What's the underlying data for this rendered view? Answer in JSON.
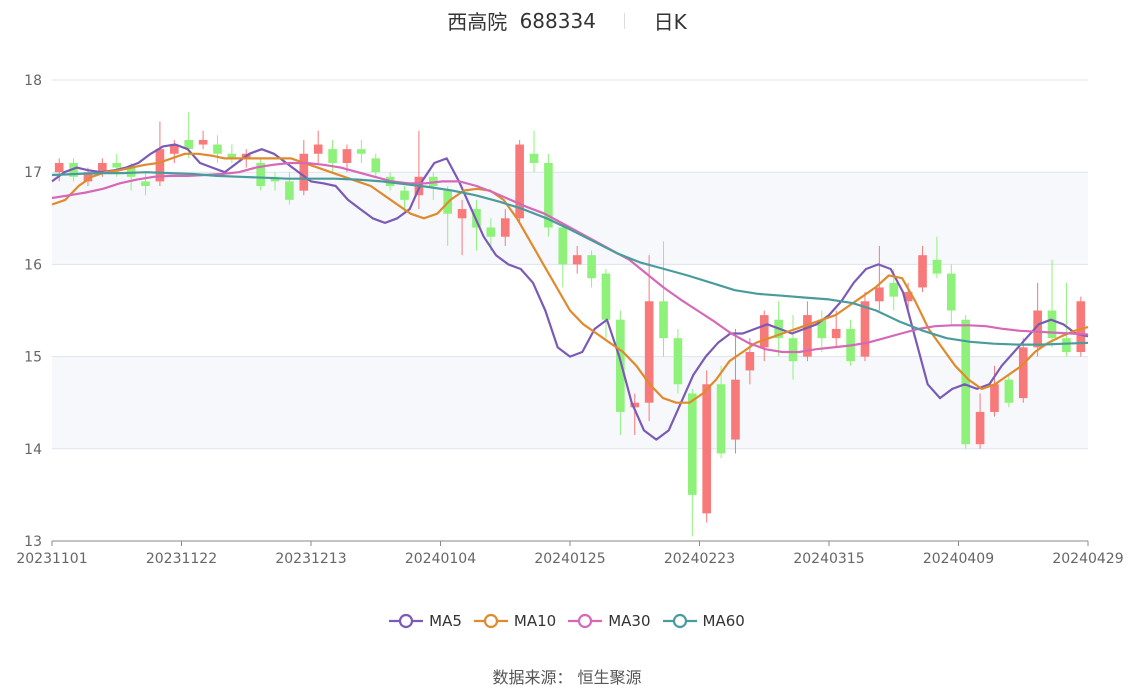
{
  "header": {
    "name": "西高院",
    "code": "688334",
    "period": "日K"
  },
  "source_text": "数据来源： 恒生聚源",
  "colors": {
    "up": "#f7797a",
    "down": "#8ef27a",
    "grid": "#dde3ee",
    "band": "#f6f8fc",
    "axis_text": "#666666"
  },
  "chart_data": {
    "type": "candlestick",
    "ylim": [
      13,
      18
    ],
    "yticks": [
      13,
      14,
      15,
      16,
      17,
      18
    ],
    "xticks": [
      "20231101",
      "20231122",
      "20231213",
      "20240104",
      "20240125",
      "20240223",
      "20240315",
      "20240409",
      "20240429"
    ],
    "legend_position": "bottom-center",
    "series": [
      {
        "name": "MA5",
        "color": "#7b5ab6",
        "values": [
          16.9,
          17.0,
          17.05,
          17.02,
          17.0,
          17.02,
          17.05,
          17.1,
          17.2,
          17.28,
          17.3,
          17.25,
          17.1,
          17.05,
          17.0,
          17.1,
          17.2,
          17.25,
          17.2,
          17.1,
          17.0,
          16.9,
          16.88,
          16.85,
          16.7,
          16.6,
          16.5,
          16.45,
          16.5,
          16.6,
          16.9,
          17.1,
          17.15,
          16.9,
          16.6,
          16.3,
          16.1,
          16.0,
          15.95,
          15.8,
          15.5,
          15.1,
          15.0,
          15.05,
          15.3,
          15.4,
          15.0,
          14.5,
          14.2,
          14.1,
          14.2,
          14.5,
          14.8,
          15.0,
          15.15,
          15.25,
          15.25,
          15.3,
          15.35,
          15.3,
          15.25,
          15.3,
          15.35,
          15.45,
          15.6,
          15.8,
          15.95,
          16.0,
          15.95,
          15.7,
          15.2,
          14.7,
          14.55,
          14.65,
          14.7,
          14.65,
          14.7,
          14.9,
          15.05,
          15.2,
          15.35,
          15.4,
          15.35,
          15.25,
          15.22
        ]
      },
      {
        "name": "MA10",
        "color": "#e08a2e",
        "values": [
          16.65,
          16.7,
          16.85,
          16.95,
          17.0,
          17.02,
          17.05,
          17.08,
          17.1,
          17.15,
          17.2,
          17.2,
          17.18,
          17.15,
          17.15,
          17.15,
          17.15,
          17.15,
          17.15,
          17.1,
          17.05,
          17.0,
          16.95,
          16.9,
          16.85,
          16.75,
          16.65,
          16.55,
          16.5,
          16.55,
          16.7,
          16.8,
          16.82,
          16.8,
          16.7,
          16.5,
          16.25,
          16.0,
          15.75,
          15.5,
          15.35,
          15.25,
          15.15,
          15.05,
          14.9,
          14.7,
          14.55,
          14.5,
          14.5,
          14.6,
          14.75,
          14.95,
          15.05,
          15.15,
          15.2,
          15.25,
          15.3,
          15.35,
          15.4,
          15.45,
          15.55,
          15.65,
          15.75,
          15.88,
          15.85,
          15.6,
          15.3,
          15.1,
          14.9,
          14.75,
          14.65,
          14.7,
          14.8,
          14.9,
          15.05,
          15.15,
          15.22,
          15.28,
          15.32
        ]
      },
      {
        "name": "MA30",
        "color": "#d668b8",
        "values": [
          16.72,
          16.75,
          16.78,
          16.82,
          16.88,
          16.92,
          16.95,
          16.96,
          16.96,
          16.97,
          16.98,
          17.0,
          17.05,
          17.08,
          17.1,
          17.1,
          17.08,
          17.05,
          17.0,
          16.95,
          16.9,
          16.88,
          16.88,
          16.9,
          16.9,
          16.85,
          16.78,
          16.7,
          16.62,
          16.55,
          16.45,
          16.35,
          16.25,
          16.15,
          16.05,
          15.9,
          15.75,
          15.62,
          15.5,
          15.38,
          15.25,
          15.15,
          15.08,
          15.05,
          15.05,
          15.08,
          15.1,
          15.12,
          15.15,
          15.2,
          15.25,
          15.3,
          15.33,
          15.34,
          15.34,
          15.33,
          15.3,
          15.28,
          15.27,
          15.26,
          15.25,
          15.24
        ]
      },
      {
        "name": "MA60",
        "color": "#4a9c9c",
        "values": [
          16.97,
          16.98,
          16.99,
          16.99,
          17.0,
          16.99,
          16.98,
          16.96,
          16.95,
          16.94,
          16.93,
          16.93,
          16.93,
          16.92,
          16.9,
          16.87,
          16.84,
          16.8,
          16.75,
          16.68,
          16.6,
          16.5,
          16.38,
          16.25,
          16.12,
          16.02,
          15.95,
          15.88,
          15.8,
          15.72,
          15.68,
          15.66,
          15.64,
          15.62,
          15.58,
          15.5,
          15.38,
          15.28,
          15.2,
          15.16,
          15.14,
          15.13,
          15.13,
          15.14,
          15.15
        ]
      }
    ],
    "candles": [
      [
        17.0,
        17.1,
        16.9,
        17.15
      ],
      [
        17.1,
        16.95,
        16.9,
        17.15
      ],
      [
        16.9,
        17.0,
        16.85,
        17.05
      ],
      [
        17.0,
        17.1,
        16.95,
        17.15
      ],
      [
        17.1,
        17.05,
        16.95,
        17.2
      ],
      [
        17.05,
        16.95,
        16.8,
        17.1
      ],
      [
        16.9,
        16.85,
        16.75,
        17.0
      ],
      [
        16.9,
        17.25,
        16.85,
        17.55
      ],
      [
        17.2,
        17.3,
        17.1,
        17.35
      ],
      [
        17.35,
        17.25,
        17.15,
        17.65
      ],
      [
        17.3,
        17.35,
        17.25,
        17.45
      ],
      [
        17.3,
        17.2,
        17.1,
        17.4
      ],
      [
        17.2,
        17.15,
        17.1,
        17.3
      ],
      [
        17.15,
        17.2,
        17.05,
        17.25
      ],
      [
        17.1,
        16.85,
        16.8,
        17.15
      ],
      [
        16.95,
        16.9,
        16.8,
        17.0
      ],
      [
        16.9,
        16.7,
        16.65,
        17.0
      ],
      [
        16.8,
        17.2,
        16.75,
        17.35
      ],
      [
        17.2,
        17.3,
        17.1,
        17.45
      ],
      [
        17.25,
        17.1,
        17.0,
        17.35
      ],
      [
        17.1,
        17.25,
        17.0,
        17.3
      ],
      [
        17.25,
        17.2,
        17.1,
        17.35
      ],
      [
        17.15,
        17.0,
        16.95,
        17.2
      ],
      [
        16.95,
        16.85,
        16.8,
        17.0
      ],
      [
        16.8,
        16.7,
        16.55,
        16.85
      ],
      [
        16.75,
        16.95,
        16.6,
        17.45
      ],
      [
        16.95,
        16.85,
        16.7,
        17.0
      ],
      [
        16.8,
        16.55,
        16.2,
        16.85
      ],
      [
        16.5,
        16.6,
        16.1,
        16.7
      ],
      [
        16.6,
        16.4,
        16.15,
        16.7
      ],
      [
        16.4,
        16.3,
        16.15,
        16.5
      ],
      [
        16.3,
        16.5,
        16.2,
        16.6
      ],
      [
        16.5,
        17.3,
        16.45,
        17.35
      ],
      [
        17.2,
        17.1,
        17.0,
        17.45
      ],
      [
        17.1,
        16.4,
        16.3,
        17.2
      ],
      [
        16.4,
        16.0,
        15.75,
        16.45
      ],
      [
        16.0,
        16.1,
        15.9,
        16.2
      ],
      [
        16.1,
        15.85,
        15.75,
        16.15
      ],
      [
        15.9,
        15.4,
        15.2,
        15.95
      ],
      [
        15.4,
        14.4,
        14.15,
        15.5
      ],
      [
        14.45,
        14.5,
        14.15,
        14.6
      ],
      [
        14.5,
        15.6,
        14.3,
        16.1
      ],
      [
        15.6,
        15.2,
        15.0,
        16.25
      ],
      [
        15.2,
        14.7,
        14.6,
        15.3
      ],
      [
        14.6,
        13.5,
        13.05,
        14.65
      ],
      [
        13.3,
        14.7,
        13.2,
        14.85
      ],
      [
        14.7,
        13.95,
        13.9,
        14.9
      ],
      [
        14.1,
        14.75,
        13.95,
        15.3
      ],
      [
        14.85,
        15.05,
        14.7,
        15.2
      ],
      [
        15.1,
        15.45,
        14.95,
        15.5
      ],
      [
        15.4,
        15.2,
        15.0,
        15.6
      ],
      [
        15.2,
        14.95,
        14.75,
        15.45
      ],
      [
        15.0,
        15.45,
        14.95,
        15.6
      ],
      [
        15.4,
        15.2,
        15.05,
        15.5
      ],
      [
        15.2,
        15.3,
        15.1,
        15.5
      ],
      [
        15.3,
        14.95,
        14.9,
        15.4
      ],
      [
        15.0,
        15.6,
        14.95,
        15.7
      ],
      [
        15.6,
        15.75,
        15.5,
        16.2
      ],
      [
        15.8,
        15.65,
        15.5,
        15.95
      ],
      [
        15.6,
        15.7,
        15.5,
        15.8
      ],
      [
        15.75,
        16.1,
        15.7,
        16.2
      ],
      [
        16.05,
        15.9,
        15.85,
        16.3
      ],
      [
        15.9,
        15.5,
        15.35,
        16.0
      ],
      [
        15.4,
        14.05,
        14.0,
        15.45
      ],
      [
        14.05,
        14.4,
        14.0,
        14.6
      ],
      [
        14.4,
        14.7,
        14.35,
        14.9
      ],
      [
        14.75,
        14.5,
        14.45,
        14.8
      ],
      [
        14.55,
        15.1,
        14.5,
        15.2
      ],
      [
        15.1,
        15.5,
        15.0,
        15.8
      ],
      [
        15.5,
        15.2,
        15.1,
        16.05
      ],
      [
        15.2,
        15.05,
        15.0,
        15.8
      ],
      [
        15.05,
        15.6,
        15.0,
        15.65
      ]
    ]
  }
}
